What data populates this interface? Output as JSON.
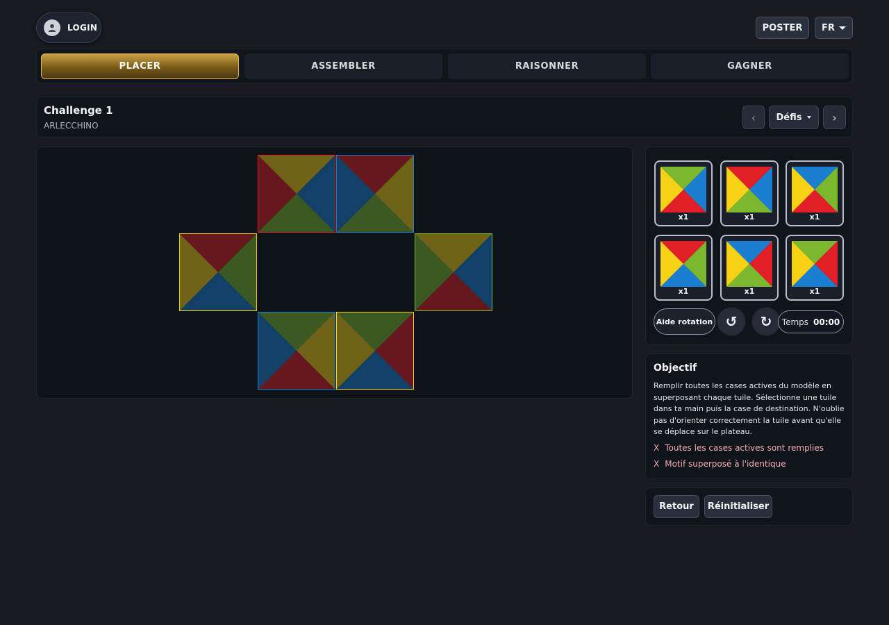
{
  "header": {
    "login_label": "LOGIN",
    "poster_label": "POSTER",
    "language": "FR"
  },
  "tabs": [
    {
      "label": "PLACER",
      "active": true
    },
    {
      "label": "ASSEMBLER",
      "active": false
    },
    {
      "label": "RAISONNER",
      "active": false
    },
    {
      "label": "GAGNER",
      "active": false
    }
  ],
  "challenge": {
    "title": "Challenge 1",
    "subtitle": "ARLECCHINO",
    "prev_icon": "‹",
    "next_icon": "›",
    "selector_label": "Défis"
  },
  "colors": {
    "red": "#e21f26",
    "yellow": "#f7d116",
    "green": "#7cb82f",
    "blue": "#1a7fd0",
    "accent_gold": "#c99a3a",
    "objective_fail": "#f2aeb3"
  },
  "board": {
    "tiles": [
      {
        "row": 0,
        "col": 1,
        "top": "yellow",
        "right": "blue",
        "bottom": "green",
        "left": "red"
      },
      {
        "row": 0,
        "col": 2,
        "top": "red",
        "right": "yellow",
        "bottom": "green",
        "left": "blue"
      },
      {
        "row": 1,
        "col": 0,
        "top": "red",
        "right": "green",
        "bottom": "blue",
        "left": "yellow"
      },
      {
        "row": 1,
        "col": 3,
        "top": "yellow",
        "right": "blue",
        "bottom": "red",
        "left": "green"
      },
      {
        "row": 2,
        "col": 1,
        "top": "green",
        "right": "yellow",
        "bottom": "red",
        "left": "blue"
      },
      {
        "row": 2,
        "col": 2,
        "top": "green",
        "right": "red",
        "bottom": "blue",
        "left": "yellow"
      }
    ]
  },
  "hand": {
    "tiles": [
      {
        "top": "green",
        "right": "blue",
        "bottom": "red",
        "left": "yellow",
        "count": "x1"
      },
      {
        "top": "red",
        "right": "blue",
        "bottom": "green",
        "left": "yellow",
        "count": "x1"
      },
      {
        "top": "blue",
        "right": "green",
        "bottom": "red",
        "left": "yellow",
        "count": "x1"
      },
      {
        "top": "red",
        "right": "green",
        "bottom": "blue",
        "left": "yellow",
        "count": "x1"
      },
      {
        "top": "blue",
        "right": "red",
        "bottom": "green",
        "left": "yellow",
        "count": "x1"
      },
      {
        "top": "green",
        "right": "red",
        "bottom": "blue",
        "left": "yellow",
        "count": "x1"
      }
    ],
    "rotation_help_label": "Aide rotation",
    "rotate_left_icon": "↺",
    "rotate_right_icon": "↻",
    "timer_label": "Temps",
    "timer_value": "00:00"
  },
  "objective": {
    "title": "Objectif",
    "description": "Remplir toutes les cases actives du modèle en superposant chaque tuile. Sélectionne une tuile dans ta main puis la case de destination. N'oublie pas d'orienter correctement la tuile avant qu'elle se déplace sur le plateau.",
    "checks": [
      {
        "mark": "X",
        "label": "Toutes les cases actives sont remplies"
      },
      {
        "mark": "X",
        "label": "Motif superposé à l'identique"
      }
    ]
  },
  "actions": {
    "back_label": "Retour",
    "reset_label": "Réinitialiser"
  }
}
